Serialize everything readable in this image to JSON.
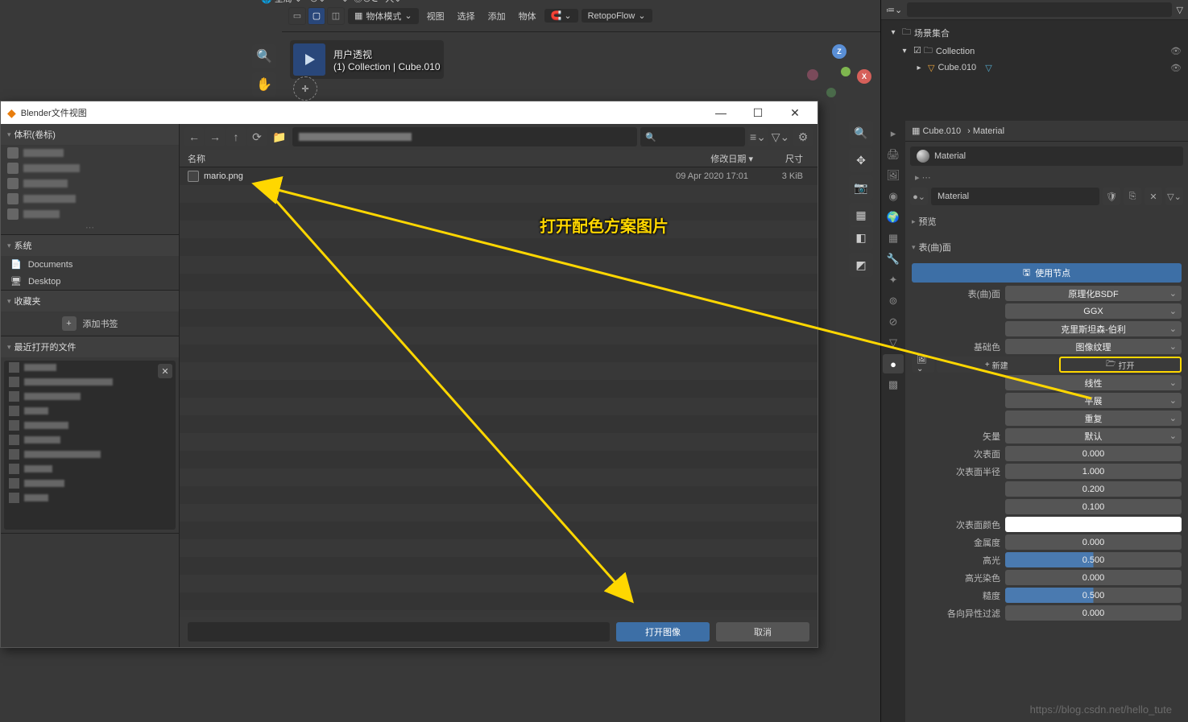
{
  "topbar": {
    "mode": "物体模式",
    "menus": [
      "视图",
      "选择",
      "添加",
      "物体"
    ],
    "addon": "RetopoFlow",
    "options": "选项"
  },
  "viewport": {
    "header1": "用户透视",
    "header2": "(1) Collection | Cube.010"
  },
  "dialog": {
    "title": "Blender文件视图",
    "volumes": "体积(卷标)",
    "system": "系统",
    "documents": "Documents",
    "desktop": "Desktop",
    "favorites": "收藏夹",
    "addbookmark": "添加书签",
    "recent": "最近打开的文件",
    "col_name": "名称",
    "col_date": "修改日期",
    "col_size": "尺寸",
    "file": {
      "name": "mario.png",
      "date": "09 Apr 2020 17:01",
      "size": "3 KiB"
    },
    "open": "打开图像",
    "cancel": "取消"
  },
  "outliner": {
    "scene": "场景集合",
    "collection": "Collection",
    "cube": "Cube.010"
  },
  "props": {
    "breadcrumb_obj": "Cube.010",
    "breadcrumb_mat": "Material",
    "mat_name": "Material",
    "preview": "预览",
    "surface": "表(曲)面",
    "usenodes": "使用节点",
    "surface_lbl": "表(曲)面",
    "bsdf": "原理化BSDF",
    "ggx": "GGX",
    "burley": "克里斯坦森-伯利",
    "basecolor": "基础色",
    "imgtex": "图像纹理",
    "new": "新建",
    "open": "打开",
    "linear": "线性",
    "flat": "平展",
    "repeat": "重复",
    "vector": "矢量",
    "default": "默认",
    "subsurf": "次表面",
    "subsurf_radius": "次表面半径",
    "r1": "1.000",
    "r2": "0.200",
    "r3": "0.100",
    "subsurf_color": "次表面颜色",
    "metallic": "金属度",
    "specular": "高光",
    "spectint": "高光染色",
    "roughness": "糙度",
    "aniso": "各向异性过滤",
    "v0": "0.000",
    "v05": "0.500"
  },
  "annotation": "打开配色方案图片",
  "watermark": "https://blog.csdn.net/hello_tute"
}
